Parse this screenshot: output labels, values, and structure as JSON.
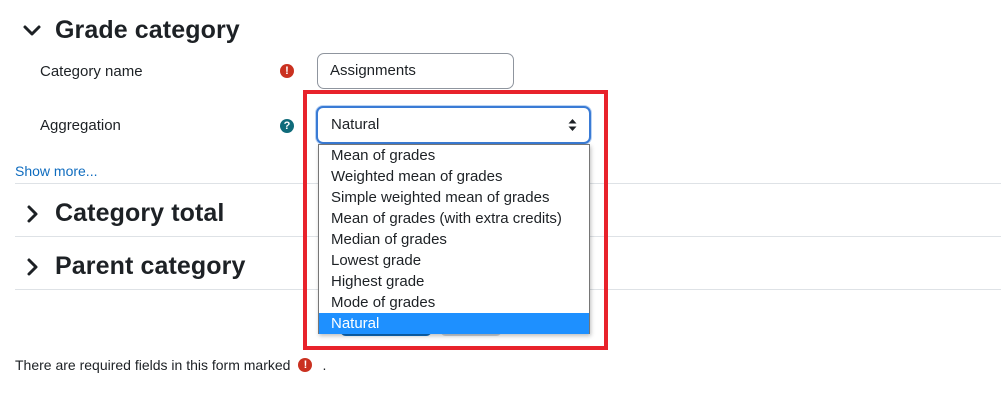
{
  "sections": {
    "grade_category": "Grade category",
    "category_total": "Category total",
    "parent_category": "Parent category"
  },
  "fields": {
    "category_name_label": "Category name",
    "category_name_value": "Assignments",
    "aggregation_label": "Aggregation",
    "aggregation_value": "Natural"
  },
  "icons": {
    "required": "!",
    "help": "?"
  },
  "aggregation_options": [
    "Mean of grades",
    "Weighted mean of grades",
    "Simple weighted mean of grades",
    "Mean of grades (with extra credits)",
    "Median of grades",
    "Lowest grade",
    "Highest grade",
    "Mode of grades",
    "Natural"
  ],
  "show_more": "Show more...",
  "footer_note": "There are required fields in this form marked",
  "footer_period": ".",
  "colors": {
    "required": "#ca3120",
    "help": "#0f6b7a",
    "link": "#0f6cbf",
    "highlight_border": "#e8222b",
    "selected_option": "#1e90ff"
  }
}
